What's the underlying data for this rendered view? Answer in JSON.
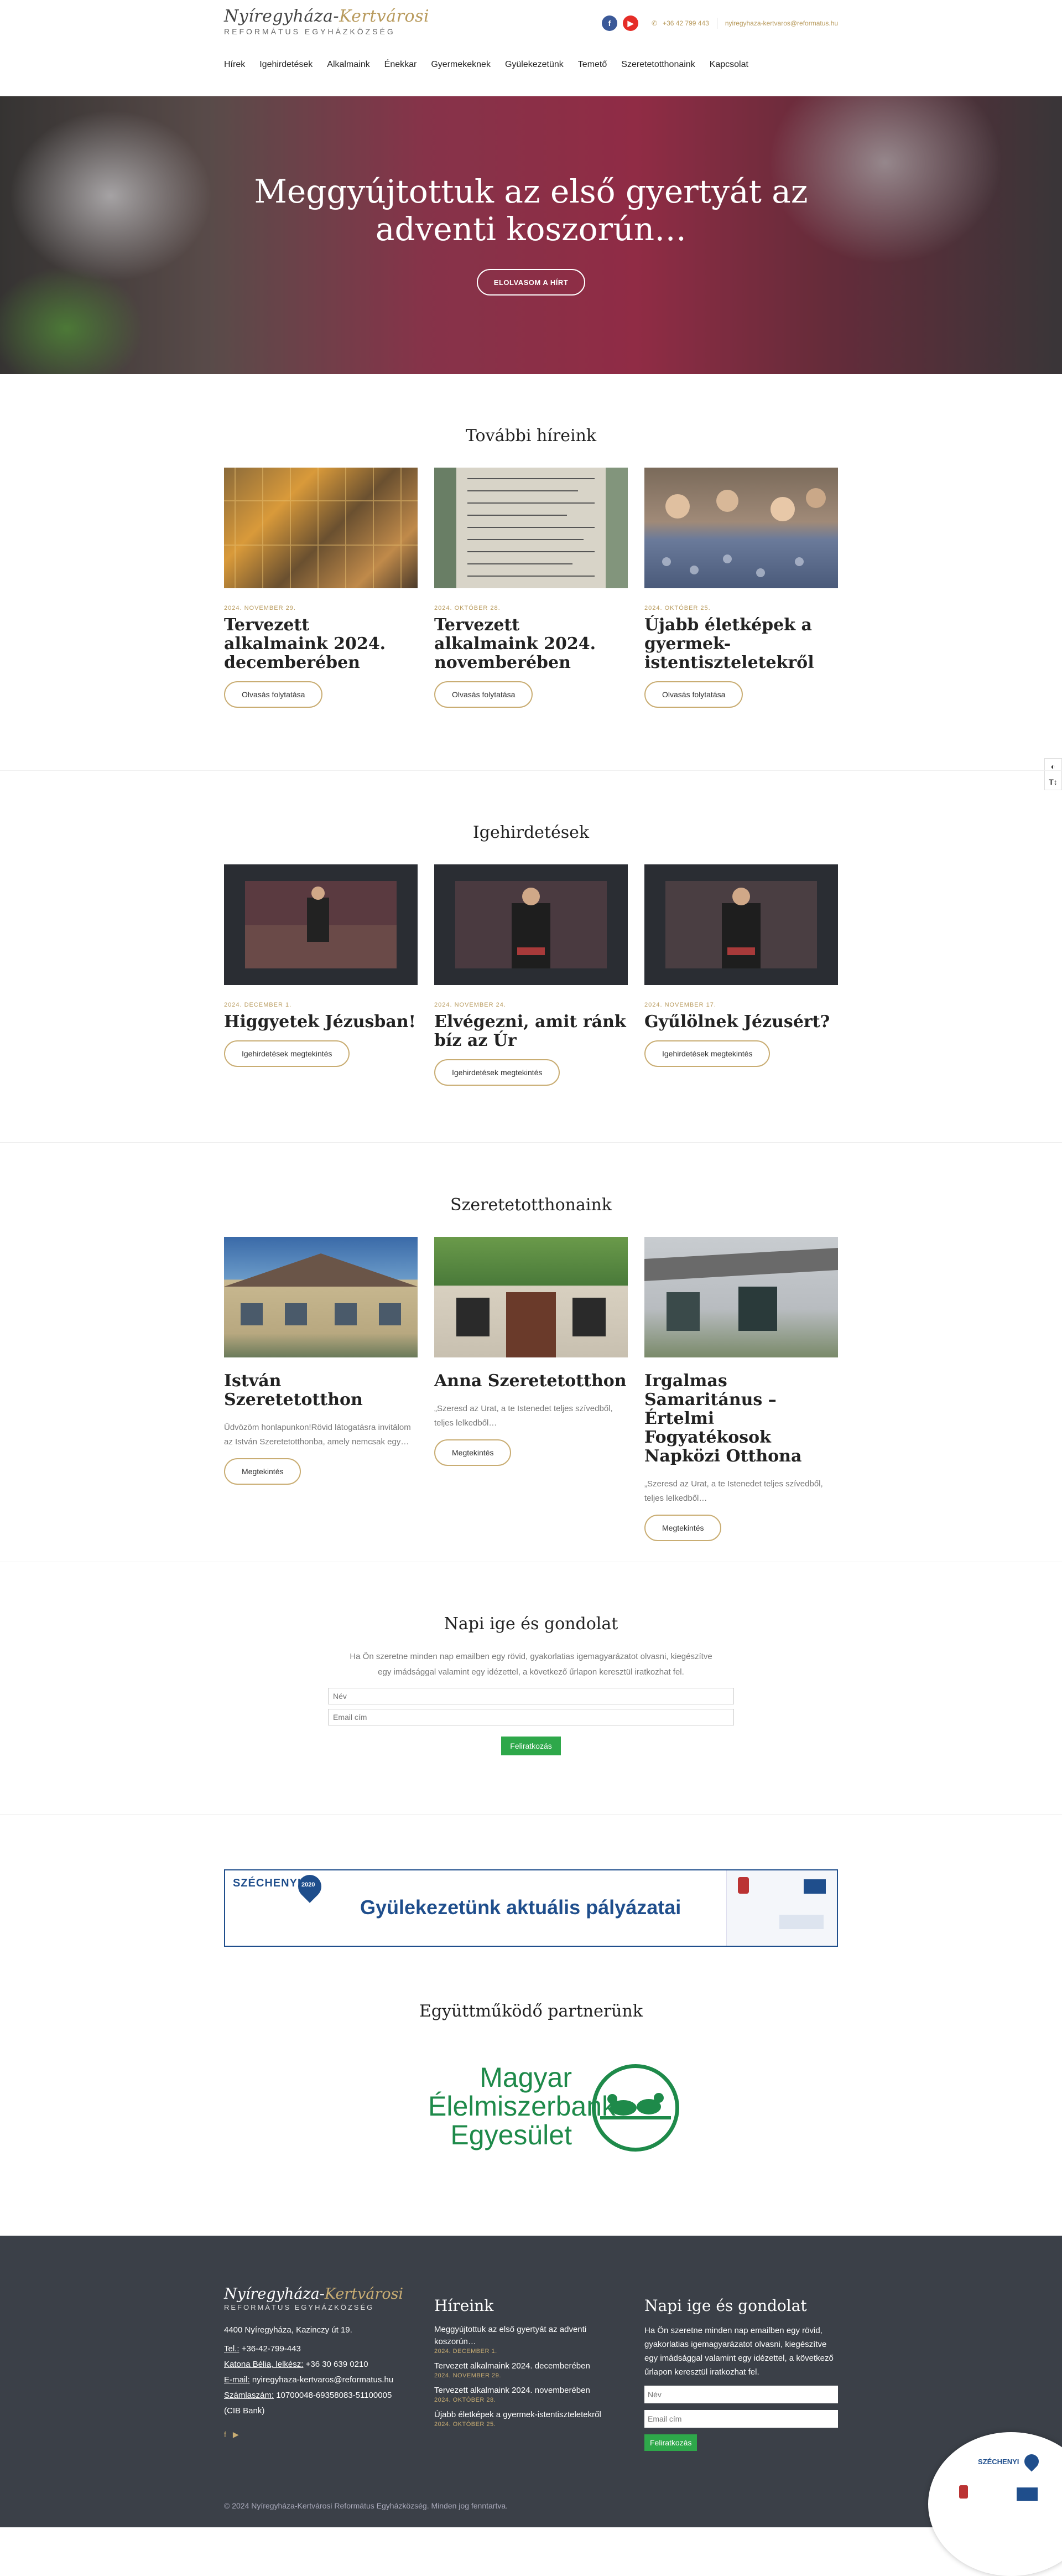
{
  "header": {
    "logo_part1": "Nyíregyháza-",
    "logo_part2": "Kertvárosi",
    "logo_sub": "REFORMÁTUS EGYHÁZKÖZSÉG",
    "phone": "+36 42 799 443",
    "email": "nyiregyhaza-kertvaros@reformatus.hu",
    "nav": [
      "Hírek",
      "Igehirdetések",
      "Alkalmaink",
      "Énekkar",
      "Gyermekeknek",
      "Gyülekezetünk",
      "Temető",
      "Szeretetotthonaink",
      "Kapcsolat"
    ]
  },
  "hero": {
    "title": "Meggyújtottuk az első gyertyát az adventi koszorún…",
    "button": "ELOLVASOM A HÍRT"
  },
  "news": {
    "title": "További híreink",
    "items": [
      {
        "date": "2024. NOVEMBER 29.",
        "title": "Tervezett alkalmaink 2024. decemberében",
        "button": "Olvasás folytatása"
      },
      {
        "date": "2024. OKTÓBER 28.",
        "title": "Tervezett alkalmaink 2024. novemberében",
        "button": "Olvasás folytatása"
      },
      {
        "date": "2024. OKTÓBER 25.",
        "title": "Újabb életképek a gyermek-istentiszteletekről",
        "button": "Olvasás folytatása"
      }
    ]
  },
  "sermons": {
    "title": "Igehirdetések",
    "items": [
      {
        "date": "2024. DECEMBER 1.",
        "title": "Higgyetek Jézusban!",
        "button": "Igehirdetések megtekintés"
      },
      {
        "date": "2024. NOVEMBER 24.",
        "title": "Elvégezni, amit ránk bíz az Úr",
        "button": "Igehirdetések megtekintés"
      },
      {
        "date": "2024. NOVEMBER 17.",
        "title": "Gyűlölnek Jézusért?",
        "button": "Igehirdetések megtekintés"
      }
    ]
  },
  "homes": {
    "title": "Szeretetotthonaink",
    "items": [
      {
        "title": "István Szeretetotthon",
        "excerpt": "Üdvözöm honlapunkon!Rövid látogatásra invitálom az István Szeretetotthonba, amely nemcsak egy…",
        "button": "Megtekintés"
      },
      {
        "title": "Anna Szeretetotthon",
        "excerpt": "„Szeresd az Urat, a te Istenedet teljes szívedből, teljes lelkedből…",
        "button": "Megtekintés"
      },
      {
        "title": "Irgalmas Samaritánus – Értelmi Fogyatékosok Napközi Otthona",
        "excerpt": "„Szeresd az Urat, a te Istenedet teljes szívedből, teljes lelkedből…",
        "button": "Megtekintés"
      }
    ]
  },
  "daily": {
    "title": "Napi ige és gondolat",
    "text1": "Ha Ön szeretne minden nap emailben egy rövid, gyakorlatias igemagyarázatot olvasni, kiegészítve",
    "text2": "egy imádsággal valamint egy idézettel, a következő űrlapon keresztül iratkozhat fel.",
    "name_placeholder": "Név",
    "email_placeholder": "Email cím",
    "button": "Feliratkozás"
  },
  "banner": {
    "brand": "SZÉCHENYI",
    "year": "2020",
    "text": "Gyülekezetünk aktuális pályázatai"
  },
  "partner": {
    "title": "Együttműködő partnerünk",
    "line1": "Magyar",
    "line2": "Élelmiszerbank",
    "line3": "Egyesület"
  },
  "footer": {
    "address": "4400 Nyíregyháza, Kazinczy út 19.",
    "tel_label": "Tel.:",
    "tel": "+36-42-799-443",
    "biblia_label": "Katona Bélia, lelkész:",
    "biblia": "+36 30 639 0210",
    "email_label": "E-mail:",
    "email": "nyiregyhaza-kertvaros@reformatus.hu",
    "account_label": "Számlaszám:",
    "account": "10700048-69358083-51100005",
    "bank": "(CIB Bank)",
    "news_title": "Híreink",
    "news": [
      {
        "title": "Meggyújtottuk az első gyertyát az adventi koszorún…",
        "date": "2024. DECEMBER 1."
      },
      {
        "title": "Tervezett alkalmaink 2024. decemberében",
        "date": "2024. NOVEMBER 29."
      },
      {
        "title": "Tervezett alkalmaink 2024. novemberében",
        "date": "2024. OKTÓBER 28."
      },
      {
        "title": "Újabb életképek a gyermek-istentiszteletekről",
        "date": "2024. OKTÓBER 25."
      }
    ],
    "daily_title": "Napi ige és gondolat",
    "daily_text": "Ha Ön szeretne minden nap emailben egy rövid, gyakorlatias igemagyarázatot olvasni, kiegészítve egy imádsággal valamint egy idézettel, a következő űrlapon keresztül iratkozhat fel.",
    "name_placeholder": "Név",
    "email_placeholder": "Email cím",
    "button": "Feliratkozás",
    "copyright": "© 2024 Nyíregyháza-Kertvárosi Református Egyházközség. Minden jog fenntartva."
  },
  "colors": {
    "gold": "#b89a5c",
    "footer_bg": "#3b4048",
    "green": "#2ea84a",
    "banner_blue": "#1f4e8c",
    "partner_green": "#1e8a4a"
  }
}
